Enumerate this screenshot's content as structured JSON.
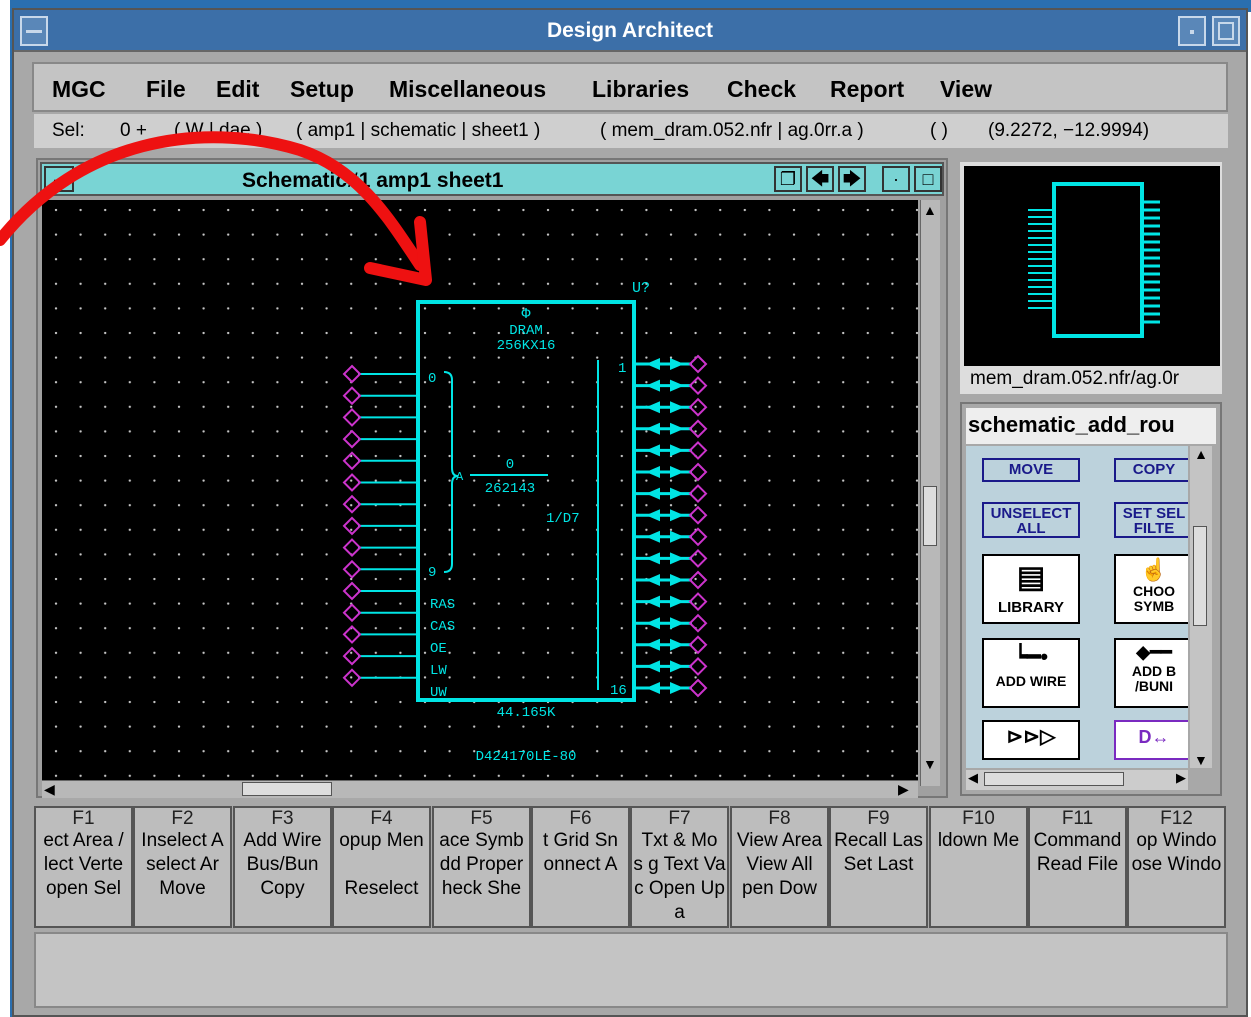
{
  "window": {
    "title": "Design Architect"
  },
  "menu": {
    "items": [
      "MGC",
      "File",
      "Edit",
      "Setup",
      "Miscellaneous",
      "Libraries",
      "Check",
      "Report",
      "View"
    ]
  },
  "status": {
    "sel_label": "Sel:",
    "sel_count": "0 +",
    "context1": "( W | dae )",
    "context2": "( amp1 | schematic | sheet1 )",
    "context3": "( mem_dram.052.nfr | ag.0rr.a )",
    "context4": "( )",
    "coords": "(9.2272, −12.9994)"
  },
  "schematic": {
    "title": "Schematic#1 amp1 sheet1",
    "component": {
      "ref": "U?",
      "type_symbol": "Φ",
      "name": "DRAM",
      "size": "256KX16",
      "addr_lo": "0",
      "addr_hi": "9",
      "range_lo": "0",
      "range_hi": "262143",
      "range_prefix": "A",
      "io_label": "1/D7",
      "out_lo": "1",
      "out_hi": "16",
      "pins": [
        "RAS",
        "CAS",
        "OE",
        "LW",
        "UW"
      ],
      "value": "44.165K",
      "part": "D424170LE-80"
    }
  },
  "preview": {
    "label": "mem_dram.052.nfr/ag.0r"
  },
  "palette": {
    "title": "schematic_add_rou",
    "buttons": {
      "move": "MOVE",
      "copy": "COPY",
      "unselect_all": "UNSELECT ALL",
      "set_select_filter": "SET SEL FILTE",
      "library": "LIBRARY",
      "choose_symbol": "CHOO SYMB",
      "add_wire": "ADD WIRE",
      "add_bus": "ADD B /BUNI"
    }
  },
  "function_keys": [
    {
      "key": "F1",
      "lines": [
        "ect Area /",
        "lect Verte",
        "open Sel"
      ]
    },
    {
      "key": "F2",
      "lines": [
        "Inselect A",
        "select Ar",
        "Move"
      ]
    },
    {
      "key": "F3",
      "lines": [
        "Add Wire",
        "Bus/Bun",
        "Copy"
      ]
    },
    {
      "key": "F4",
      "lines": [
        "opup Men",
        "",
        "Reselect"
      ]
    },
    {
      "key": "F5",
      "lines": [
        "ace Symb",
        "dd Proper",
        "heck She"
      ]
    },
    {
      "key": "F6",
      "lines": [
        "t Grid Sn",
        "onnect A",
        ""
      ]
    },
    {
      "key": "F7",
      "lines": [
        "Txt & Mo",
        "s g Text Va",
        "c Open Up",
        "a"
      ]
    },
    {
      "key": "F8",
      "lines": [
        "View Area",
        "View All",
        "pen Dow"
      ]
    },
    {
      "key": "F9",
      "lines": [
        "Recall Las",
        "Set Last",
        ""
      ]
    },
    {
      "key": "F10",
      "lines": [
        "ldown Me",
        "",
        ""
      ]
    },
    {
      "key": "F11",
      "lines": [
        "Command",
        "Read File",
        ""
      ]
    },
    {
      "key": "F12",
      "lines": [
        "op Windo",
        "ose Windo",
        ""
      ]
    }
  ],
  "colors": {
    "accent_cyan": "#00e5e5",
    "annotation_red": "#ee1111",
    "pin_magenta": "#cc33cc",
    "title_blue": "#3c6fa8"
  }
}
